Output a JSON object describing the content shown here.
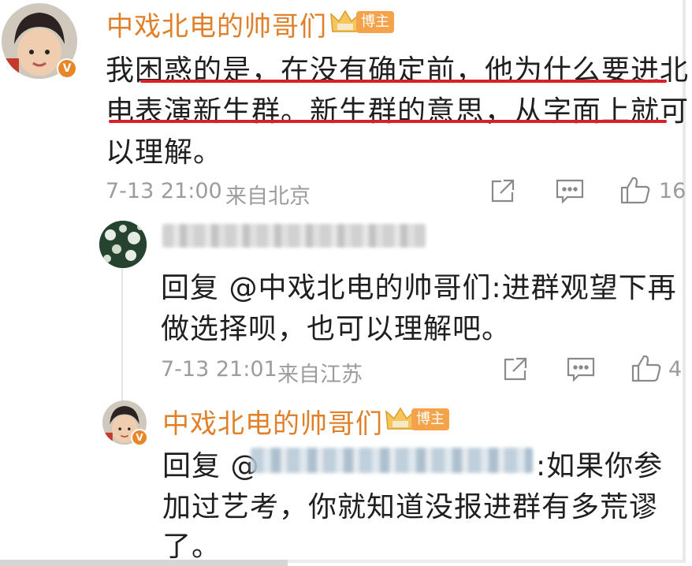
{
  "comments": [
    {
      "username": "中戏北电的帅哥们",
      "badge": "博主",
      "verified_mark": "V",
      "lines": [
        "我困惑的是，在没有确定前，他为什么要进北",
        "电表演新生群。新生群的意思，从字面上就可",
        "以理解。"
      ],
      "timestamp": "7-13 21:00",
      "source": "来自北京",
      "like_count": "16"
    },
    {
      "username_blurred": true,
      "lines": [
        "回复 @中戏北电的帅哥们:进群观望下再",
        "做选择呗，也可以理解吧。"
      ],
      "timestamp": "7-13 21:01",
      "source": "来自江苏",
      "like_count": "4"
    },
    {
      "username": "中戏北电的帅哥们",
      "badge": "博主",
      "verified_mark": "V",
      "line1_prefix": "回复 @",
      "line1_suffix": ":如果你参",
      "lines_rest": [
        "加过艺考，你就知道没报进群有多荒谬",
        "了。"
      ]
    }
  ],
  "icons": [
    "share-icon",
    "comment-icon",
    "like-icon",
    "crown-icon"
  ],
  "colors": {
    "username": "#e0802a",
    "badge": "#f5a34a",
    "underline": "#d7202a",
    "meta": "#9c9c9c"
  }
}
